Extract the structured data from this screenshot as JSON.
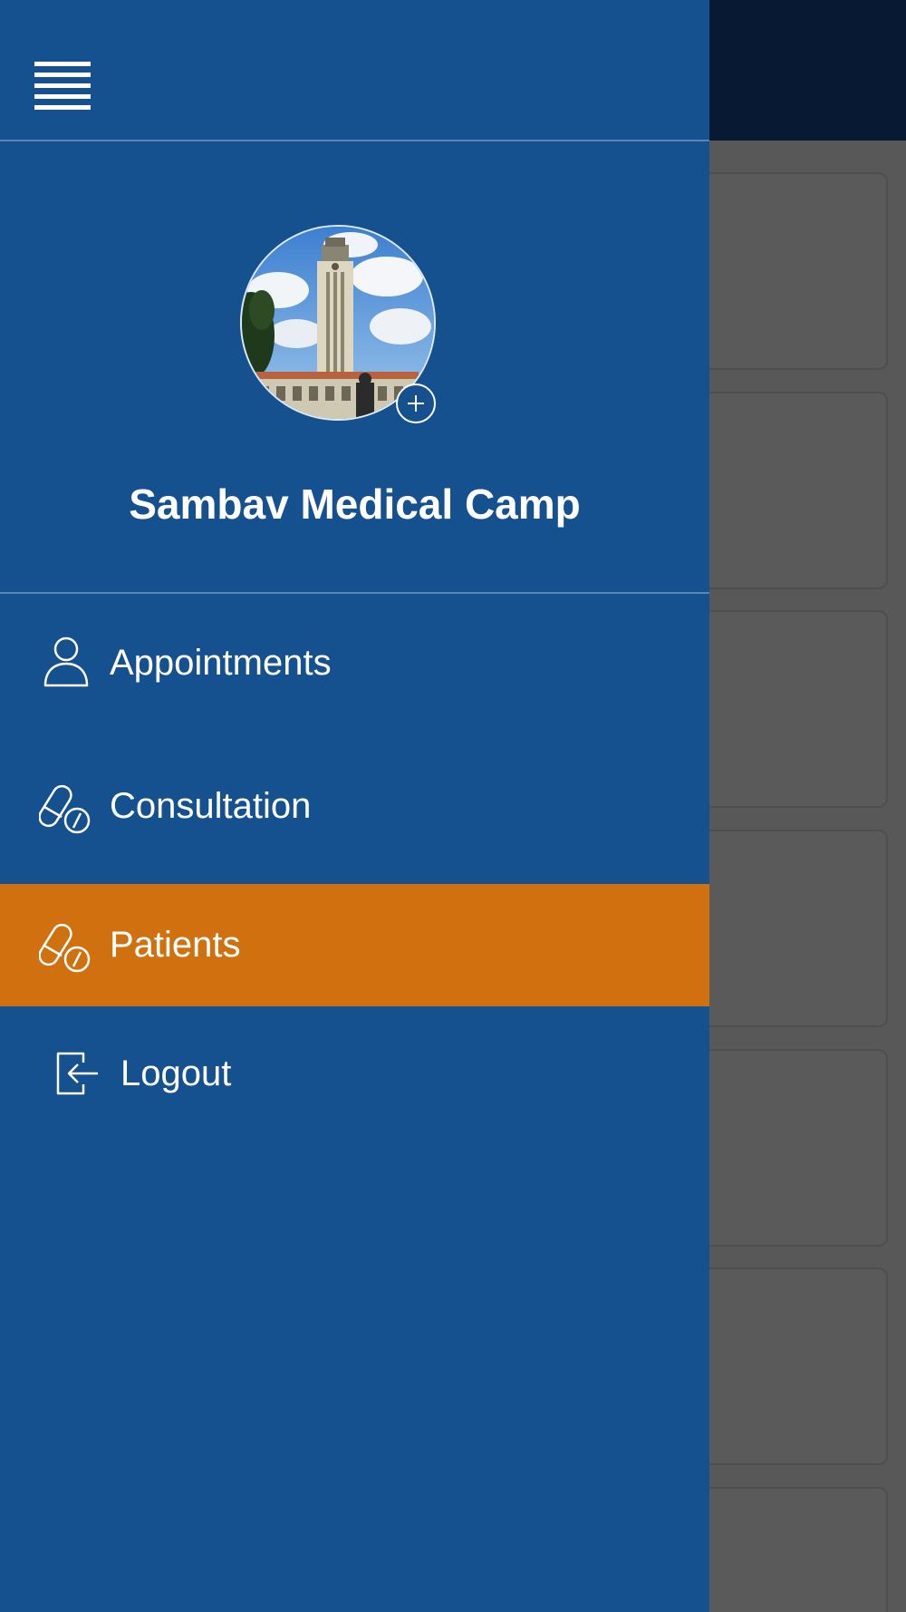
{
  "app": {
    "org_name": "Sambav Medical Camp"
  },
  "drawer": {
    "menu_icon": "hamburger-icon",
    "add_photo_icon": "plus-icon",
    "items": [
      {
        "label": "Appointments",
        "icon": "person-icon",
        "active": false
      },
      {
        "label": "Consultation",
        "icon": "pills-icon",
        "active": false
      },
      {
        "label": "Patients",
        "icon": "pills-icon",
        "active": true
      },
      {
        "label": "Logout",
        "icon": "logout-icon",
        "active": false
      }
    ]
  },
  "colors": {
    "drawer_bg": "#15508f",
    "active_bg": "#d0700e",
    "overlay_bg": "#585858",
    "header_bg": "#081a33"
  }
}
